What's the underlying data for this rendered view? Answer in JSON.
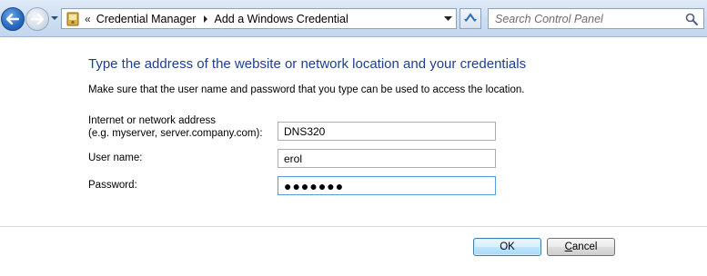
{
  "navigation": {
    "breadcrumbs": [
      "Credential Manager",
      "Add a Windows Credential"
    ],
    "overflow_glyph": "«",
    "search_placeholder": "Search Control Panel"
  },
  "main": {
    "heading": "Type the address of the website or network location and your credentials",
    "instruction": "Make sure that the user name and password that you type can be used to access the location.",
    "fields": {
      "address_label_line1": "Internet or network address",
      "address_label_line2": "(e.g. myserver, server.company.com):",
      "address_value": "DNS320",
      "username_label": "User name:",
      "username_value": "erol",
      "password_label": "Password:",
      "password_value": "●●●●●●●"
    }
  },
  "buttons": {
    "ok_label": "OK",
    "cancel_prefix": "",
    "cancel_mnemonic": "C",
    "cancel_rest": "ancel"
  },
  "colors": {
    "heading": "#1e3f8f",
    "navbar": "#cfdff2",
    "default_button": "#bee6fd"
  },
  "icons": {
    "back": "back-arrow-icon",
    "forward": "forward-arrow-icon",
    "history": "chevron-down-icon",
    "location": "credential-manager-icon",
    "separator": "breadcrumb-arrow-icon",
    "address_dropdown": "chevron-down-icon",
    "refresh": "refresh-icon",
    "search": "search-icon"
  }
}
